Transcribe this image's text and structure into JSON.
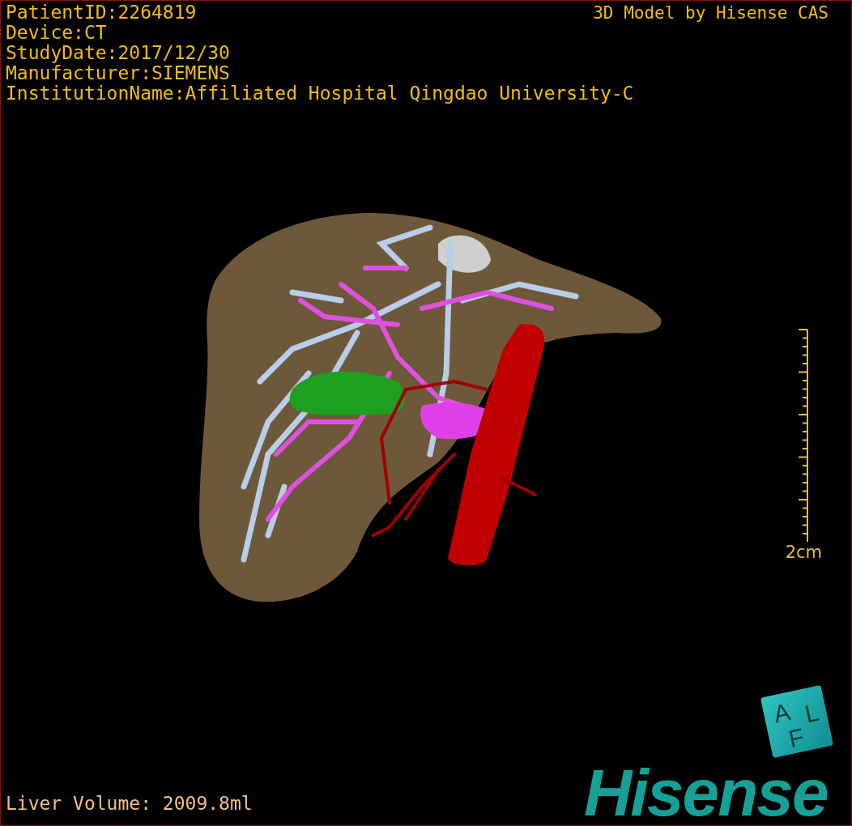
{
  "study_info": [
    "PatientID:2264819",
    "Device:CT",
    "StudyDate:2017/12/30",
    "Manufacturer:SIEMENS",
    "InstitutionName:Affiliated Hospital Qingdao University-C"
  ],
  "model_credit": "3D Model by Hisense CAS",
  "scale_bar": {
    "label": "2cm"
  },
  "liver_volume": "Liver Volume: 2009.8ml",
  "orientation_cube": {
    "faces": [
      "A",
      "L",
      "F"
    ]
  },
  "logo": "Hisense"
}
